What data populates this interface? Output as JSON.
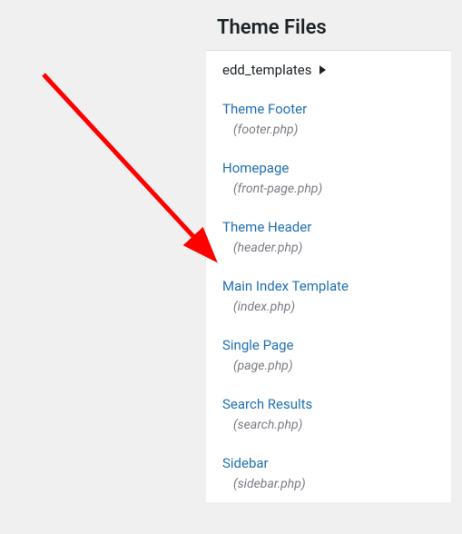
{
  "panel": {
    "title": "Theme Files"
  },
  "folder": {
    "name": "edd_templates"
  },
  "files": [
    {
      "label": "Theme Footer",
      "filename": "(footer.php)"
    },
    {
      "label": "Homepage",
      "filename": "(front-page.php)"
    },
    {
      "label": "Theme Header",
      "filename": "(header.php)"
    },
    {
      "label": "Main Index Template",
      "filename": "(index.php)"
    },
    {
      "label": "Single Page",
      "filename": "(page.php)"
    },
    {
      "label": "Search Results",
      "filename": "(search.php)"
    },
    {
      "label": "Sidebar",
      "filename": "(sidebar.php)"
    }
  ]
}
